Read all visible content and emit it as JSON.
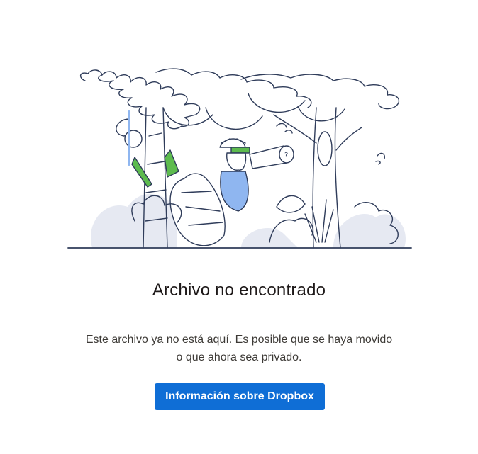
{
  "error": {
    "title": "Archivo no encontrado",
    "message_line1": "Este archivo ya no está aquí. Es posible que se haya movido",
    "message_line2": "o que ahora sea privado.",
    "button_label": "Información sobre Dropbox"
  },
  "colors": {
    "button": "#0f6ed6",
    "line": "#2f3c5a",
    "green": "#5dbb4e",
    "blue": "#8fb6f0",
    "shade": "#e4e7f0"
  },
  "illustration": {
    "name": "jungle-explorer-illustration"
  }
}
